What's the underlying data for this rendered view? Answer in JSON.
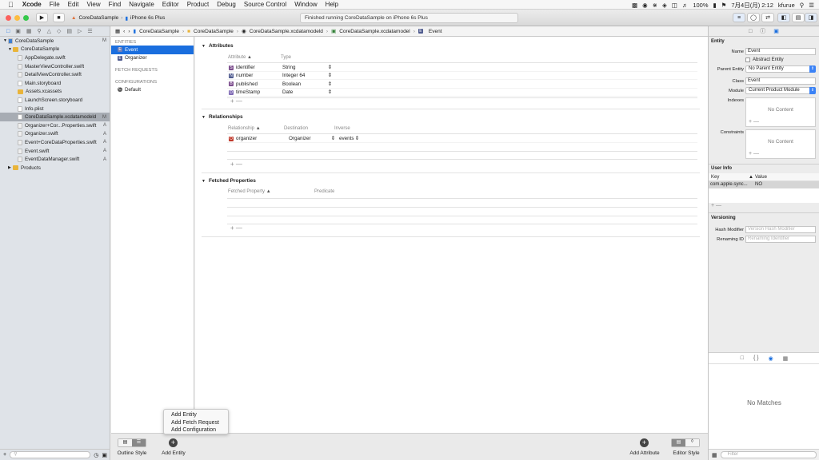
{
  "menubar": {
    "app": "Xcode",
    "items": [
      "File",
      "Edit",
      "View",
      "Find",
      "Navigate",
      "Editor",
      "Product",
      "Debug",
      "Source Control",
      "Window",
      "Help"
    ],
    "battery": "100%",
    "datetime": "7月4日(月) 2:12",
    "user": "kfurue"
  },
  "toolbar": {
    "scheme": "CoreDataSample",
    "device": "iPhone 6s Plus",
    "activity": "Finished running CoreDataSample on iPhone 6s Plus"
  },
  "navigator": {
    "items": [
      {
        "label": "CoreDataSample",
        "flag": "M",
        "type": "project",
        "indent": 0,
        "selected": false
      },
      {
        "label": "CoreDataSample",
        "flag": "",
        "type": "folder",
        "indent": 1,
        "selected": false
      },
      {
        "label": "AppDelegate.swift",
        "flag": "",
        "type": "swift",
        "indent": 2,
        "selected": false
      },
      {
        "label": "MasterViewController.swift",
        "flag": "",
        "type": "swift",
        "indent": 2,
        "selected": false
      },
      {
        "label": "DetailViewController.swift",
        "flag": "",
        "type": "swift",
        "indent": 2,
        "selected": false
      },
      {
        "label": "Main.storyboard",
        "flag": "",
        "type": "sb",
        "indent": 2,
        "selected": false
      },
      {
        "label": "Assets.xcassets",
        "flag": "",
        "type": "folder",
        "indent": 2,
        "selected": false
      },
      {
        "label": "LaunchScreen.storyboard",
        "flag": "",
        "type": "sb",
        "indent": 2,
        "selected": false
      },
      {
        "label": "Info.plist",
        "flag": "",
        "type": "sb",
        "indent": 2,
        "selected": false
      },
      {
        "label": "CoreDataSample.xcdatamodeld",
        "flag": "M",
        "type": "sb",
        "indent": 2,
        "selected": true
      },
      {
        "label": "Organizer+Cor...Properties.swift",
        "flag": "A",
        "type": "swift",
        "indent": 2,
        "selected": false
      },
      {
        "label": "Organizer.swift",
        "flag": "A",
        "type": "swift",
        "indent": 2,
        "selected": false
      },
      {
        "label": "Event+CoreDataProperties.swift",
        "flag": "A",
        "type": "swift",
        "indent": 2,
        "selected": false
      },
      {
        "label": "Event.swift",
        "flag": "A",
        "type": "swift",
        "indent": 2,
        "selected": false
      },
      {
        "label": "EventDataManager.swift",
        "flag": "A",
        "type": "swift",
        "indent": 2,
        "selected": false
      },
      {
        "label": "Products",
        "flag": "",
        "type": "folder",
        "indent": 1,
        "selected": false
      }
    ]
  },
  "jumpbar": [
    "CoreDataSample",
    "CoreDataSample",
    "CoreDataSample.xcdatamodeld",
    "CoreDataSample.xcdatamodel",
    "Event"
  ],
  "entities": {
    "entities_header": "ENTITIES",
    "entity_list": [
      "Event",
      "Organizer"
    ],
    "fetch_header": "FETCH REQUESTS",
    "config_header": "CONFIGURATIONS",
    "config_list": [
      "Default"
    ]
  },
  "attributes": {
    "title": "Attributes",
    "col_attribute": "Attribute",
    "col_type": "Type",
    "rows": [
      {
        "badge": "S",
        "name": "identifier",
        "type": "String",
        "color": "#7d4e8e"
      },
      {
        "badge": "N",
        "name": "number",
        "type": "Integer 64",
        "color": "#4e5a8e"
      },
      {
        "badge": "B",
        "name": "published",
        "type": "Boolean",
        "color": "#7d4e8e"
      },
      {
        "badge": "D",
        "name": "timeStamp",
        "type": "Date",
        "color": "#7f6ab5"
      }
    ]
  },
  "relationships": {
    "title": "Relationships",
    "col_relationship": "Relationship",
    "col_destination": "Destination",
    "col_inverse": "Inverse",
    "rows": [
      {
        "badge": "O",
        "name": "organizer",
        "destination": "Organizer",
        "inverse": "events",
        "color": "#c0392b"
      }
    ]
  },
  "fetched": {
    "title": "Fetched Properties",
    "col_fetched": "Fetched Property",
    "col_predicate": "Predicate"
  },
  "plusminus": "+  —",
  "bottom": {
    "outline_style": "Outline Style",
    "add_entity": "Add Entity",
    "add_attribute": "Add Attribute",
    "editor_style": "Editor Style",
    "popup": [
      "Add Entity",
      "Add Fetch Request",
      "Add Configuration"
    ]
  },
  "inspector": {
    "entity_header": "Entity",
    "name_label": "Name",
    "name_value": "Event",
    "abstract_label": "Abstract Entity",
    "parent_label": "Parent Entity",
    "parent_value": "No Parent Entity",
    "class_label": "Class",
    "class_value": "Event",
    "module_label": "Module",
    "module_value": "Current Product Module",
    "indexes_label": "Indexes",
    "constraints_label": "Constraints",
    "no_content": "No Content",
    "userinfo_header": "User Info",
    "key_col": "Key",
    "value_col": "Value",
    "userinfo_key": "com.apple.sync...",
    "userinfo_value": "NO",
    "versioning_header": "Versioning",
    "hash_label": "Hash Modifier",
    "hash_placeholder": "Version Hash Modifier",
    "renaming_label": "Renaming ID",
    "renaming_placeholder": "Renaming Identifier",
    "no_matches": "No Matches",
    "filter_placeholder": "Filter"
  }
}
